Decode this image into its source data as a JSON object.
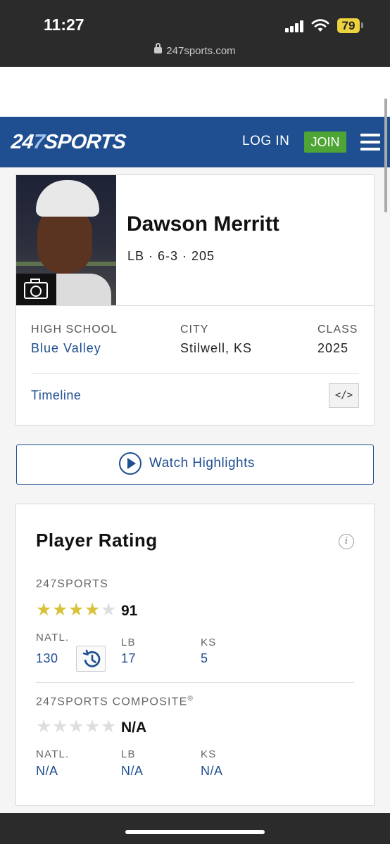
{
  "status_bar": {
    "time": "11:27",
    "battery": "79",
    "url": "247sports.com"
  },
  "nav": {
    "logo_main": "24",
    "logo_seven": "7",
    "logo_sports": "SPORTS",
    "login": "LOG IN",
    "join": "JOIN"
  },
  "player": {
    "name": "Dawson Merritt",
    "meta": "LB · 6-3 · 205"
  },
  "info": {
    "high_school_label": "HIGH SCHOOL",
    "high_school": "Blue Valley",
    "city_label": "CITY",
    "city": "Stilwell, KS",
    "class_label": "CLASS",
    "class": "2025"
  },
  "timeline": "Timeline",
  "embed_symbol": "</>",
  "watch_highlights": "Watch Highlights",
  "rating": {
    "title": "Player Rating",
    "info_symbol": "i",
    "sports247": {
      "label": "247SPORTS",
      "stars": 4,
      "max_stars": 5,
      "score": "91",
      "natl_label": "NATL.",
      "natl": "130",
      "pos_label": "LB",
      "pos": "17",
      "state_label": "KS",
      "state": "5"
    },
    "composite": {
      "label": "247SPORTS COMPOSITE",
      "reg": "®",
      "stars": 0,
      "max_stars": 5,
      "score": "N/A",
      "natl_label": "NATL.",
      "natl": "N/A",
      "pos_label": "LB",
      "pos": "N/A",
      "state_label": "KS",
      "state": "N/A"
    }
  },
  "colors": {
    "brand_blue": "#1f4f91",
    "join_green": "#4ea535",
    "star_gold": "#d6c33a"
  }
}
